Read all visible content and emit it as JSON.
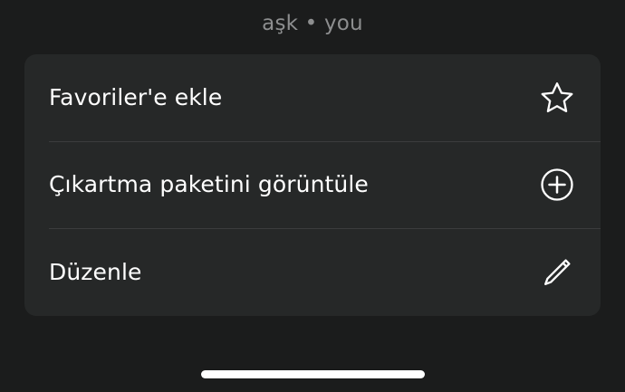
{
  "header": {
    "title": "aşk • you"
  },
  "menu": {
    "items": [
      {
        "label": "Favoriler'e ekle",
        "icon": "star-outline-icon"
      },
      {
        "label": "Çıkartma paketini görüntüle",
        "icon": "plus-circle-icon"
      },
      {
        "label": "Düzenle",
        "icon": "pencil-icon"
      }
    ]
  },
  "colors": {
    "background": "#1b1c1c",
    "card": "#262828",
    "text": "#ffffff",
    "muted_text": "#8d8e8f",
    "separator": "#3b3c3d"
  }
}
